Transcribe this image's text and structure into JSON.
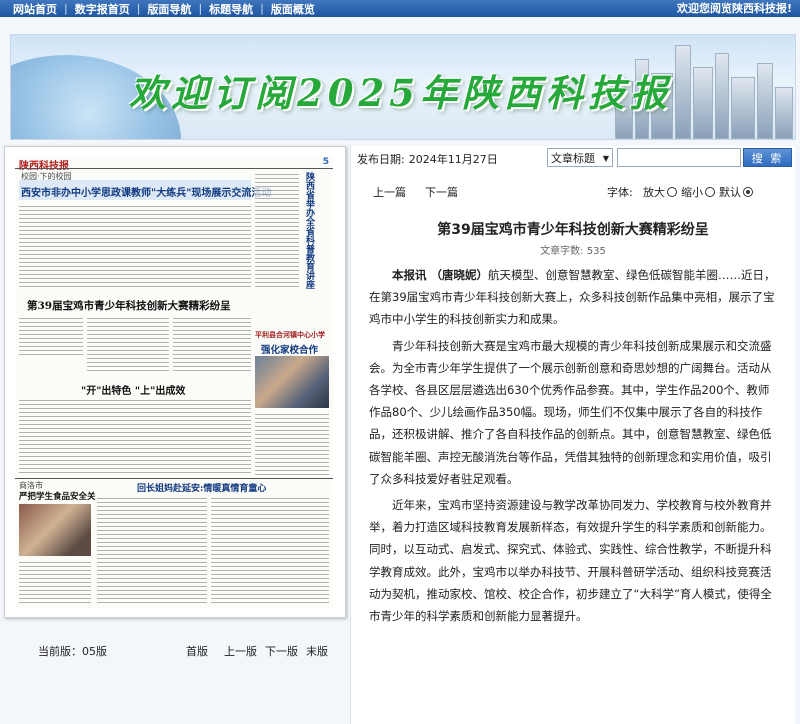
{
  "topnav": {
    "items": [
      "网站首页",
      "数字报首页",
      "版面导航",
      "标题导航",
      "版面概览"
    ],
    "welcome": "欢迎您阅览陕西科技报!"
  },
  "banner": {
    "title": "欢迎订阅2025年陕西科技报"
  },
  "newspaper": {
    "masthead": "陕西科技报",
    "page_number": "5",
    "section_label": "校园·下的校园",
    "headline1": "西安市非办中小学思政课教师\"大练兵\"现场展示交流活动",
    "headline2": "第39届宝鸡市青少年科技创新大赛精彩纷呈",
    "headline3": "\"开\"出特色 \"上\"出成效",
    "headline4": "回长姐妈赴延安:情暖真情育童心",
    "side_title": "陕西省举办全省科普教育讲座",
    "side_box": "强化家校合作",
    "side_box_sub": "平利县合河镇中心小学",
    "left_bottom_title": "严把学生食品安全关",
    "left_bottom_sub": "商洛市"
  },
  "page_controls": {
    "current_label": "当前版：05版",
    "first": "首版",
    "prev": "上一版",
    "next": "下一版",
    "last": "末版"
  },
  "article_panel": {
    "pubdate_label": "发布日期:",
    "pubdate": "2024年11月27日",
    "search_select": "文章标题",
    "search_button": "搜 索",
    "prev_article": "上一篇",
    "next_article": "下一篇",
    "font_label": "字体:",
    "font_big": "放大",
    "font_small": "缩小",
    "font_default": "默认",
    "title": "第39届宝鸡市青少年科技创新大赛精彩纷呈",
    "word_count": "文章字数: 535",
    "para1_lead": "本报讯 （唐晓妮）",
    "para1": "航天模型、创意智慧教室、绿色低碳智能羊圈……近日，在第39届宝鸡市青少年科技创新大赛上，众多科技创新作品集中亮相，展示了宝鸡市中小学生的科技创新实力和成果。",
    "para2": "青少年科技创新大赛是宝鸡市最大规模的青少年科技创新成果展示和交流盛会。为全市青少年学生提供了一个展示创新创意和奇思妙想的广阔舞台。活动从各学校、各县区层层遴选出630个优秀作品参赛。其中，学生作品200个、教师作品80个、少儿绘画作品350幅。现场，师生们不仅集中展示了各自的科技作品，还积极讲解、推介了各自科技作品的创新点。其中，创意智慧教室、绿色低碳智能羊圈、声控无酸消洗台等作品，凭借其独特的创新理念和实用价值，吸引了众多科技爱好者驻足观看。",
    "para3": "近年来，宝鸡市坚持资源建设与教学改革协同发力、学校教育与校外教育并举，着力打造区域科技教育发展新样态，有效提升学生的科学素质和创新能力。同时，以互动式、启发式、探究式、体验式、实践性、综合性教学，不断提升科学教育成效。此外，宝鸡市以举办科技节、开展科普研学活动、组织科技竞赛活动为契机，推动家校、馆校、校企合作，初步建立了“大科学”育人模式，使得全市青少年的科学素质和创新能力显著提升。"
  }
}
